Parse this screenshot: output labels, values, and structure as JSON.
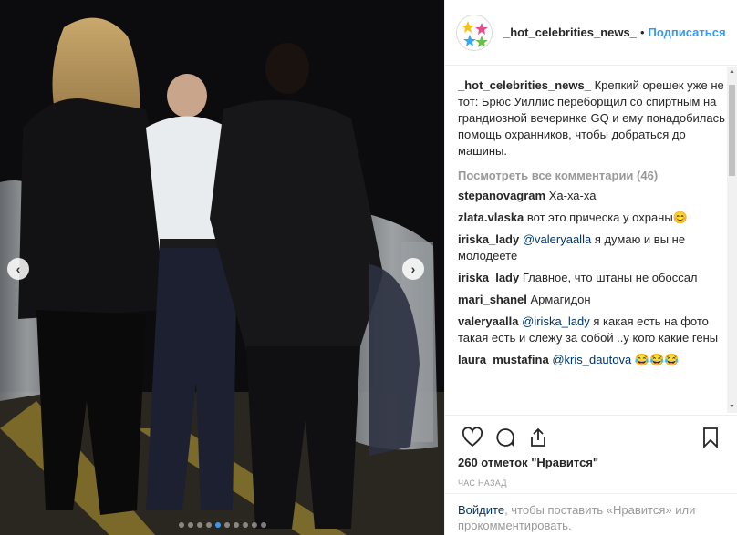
{
  "post": {
    "username": "_hot_celebrities_news_",
    "follow_label": "Подписаться",
    "bullet": "•",
    "caption_user": "_hot_celebrities_news_",
    "caption_text": "Крепкий орешек уже не тот: Брюс Уиллис переборщил со спиртным на грандиозной вечеринке GQ и ему понадобилась помощь охранников, чтобы добраться до машины.",
    "view_all_comments": "Посмотреть все комментарии (46)",
    "comments": [
      {
        "user": "stepanovagram",
        "mention": "",
        "text": "Ха-ха-ха"
      },
      {
        "user": "zlata.vlaska",
        "mention": "",
        "text": "вот это прическа у охраны😊"
      },
      {
        "user": "iriska_lady",
        "mention": "@valeryaalla",
        "text": "я думаю и вы не молодеете"
      },
      {
        "user": "iriska_lady",
        "mention": "",
        "text": "Главное, что штаны не обоссал"
      },
      {
        "user": "mari_shanel",
        "mention": "",
        "text": "Армагидон"
      },
      {
        "user": "valeryaalla",
        "mention": "@iriska_lady",
        "text": "я какая есть на фото такая есть и слежу за собой ..у кого какие гены"
      },
      {
        "user": "laura_mustafina",
        "mention": "@kris_dautova",
        "text": "😂😂😂"
      }
    ],
    "likes": "260 отметок \"Нравится\"",
    "time_ago": "ЧАС НАЗАД",
    "login_link": "Войдите",
    "login_text": ", чтобы поставить «Нравится» или прокомментировать."
  },
  "media": {
    "carousel_total": 10,
    "carousel_active": 5,
    "prev_icon": "chevron-left-icon",
    "next_icon": "chevron-right-icon"
  },
  "colors": {
    "accent": "#3897f0",
    "mention": "#003569",
    "muted": "#999999"
  }
}
